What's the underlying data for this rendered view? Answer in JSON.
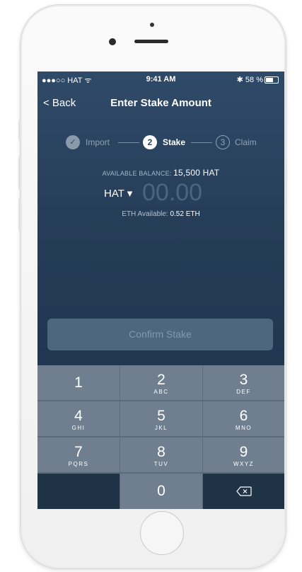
{
  "status_bar": {
    "carrier": "●●●○○ HAT ᯤ",
    "time": "9:41 AM",
    "battery": "✱ 58 %"
  },
  "nav": {
    "back_label": "< Back",
    "title": "Enter Stake Amount"
  },
  "steps": [
    {
      "number": "✓",
      "label": "Import",
      "state": "done"
    },
    {
      "number": "2",
      "label": "Stake",
      "state": "active"
    },
    {
      "number": "3",
      "label": "Claim",
      "state": "pending"
    }
  ],
  "balance": {
    "label": "AVAILABLE BALANCE:",
    "value": "15,500 HAT"
  },
  "amount": {
    "currency": "HAT ▾",
    "placeholder": "00.00"
  },
  "eth_available": {
    "label": "ETH Available:",
    "value": "0.52 ETH"
  },
  "confirm_label": "Confirm Stake",
  "keypad": [
    {
      "digit": "1",
      "letters": ""
    },
    {
      "digit": "2",
      "letters": "ABC"
    },
    {
      "digit": "3",
      "letters": "DEF"
    },
    {
      "digit": "4",
      "letters": "GHI"
    },
    {
      "digit": "5",
      "letters": "JKL"
    },
    {
      "digit": "6",
      "letters": "MNO"
    },
    {
      "digit": "7",
      "letters": "PQRS"
    },
    {
      "digit": "8",
      "letters": "TUV"
    },
    {
      "digit": "9",
      "letters": "WXYZ"
    },
    {
      "digit": "0",
      "letters": ""
    }
  ],
  "colors": {
    "screen_bg": "#263d58",
    "key_bg": "#6f7f90",
    "key_dark": "#1f3347",
    "confirm_bg": "#4e6680"
  }
}
